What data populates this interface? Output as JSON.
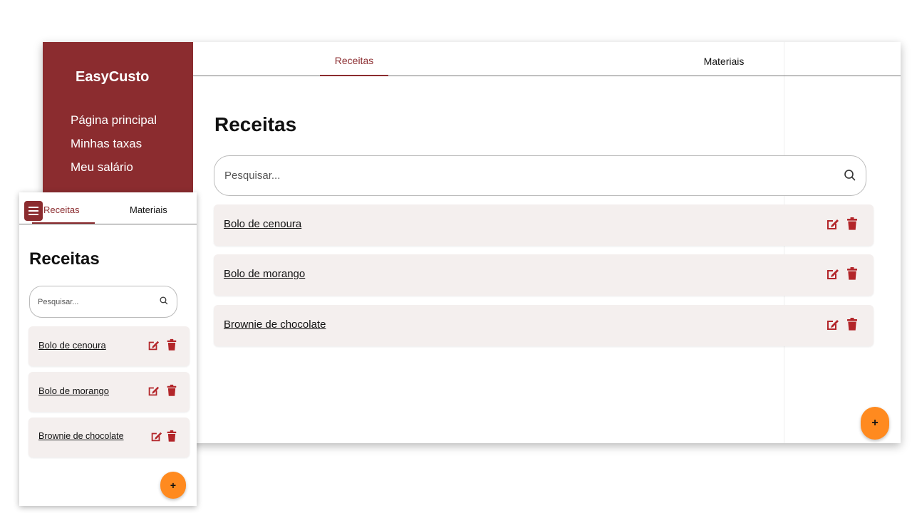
{
  "colors": {
    "brand": "#8b2c2f",
    "accent_fab": "#ff8a1f",
    "row_bg": "#f4efee",
    "icon_red": "#b3262a"
  },
  "desktop": {
    "brand": "EasyCusto",
    "sidebar": {
      "items": [
        {
          "label": "Página principal"
        },
        {
          "label": "Minhas taxas"
        },
        {
          "label": "Meu salário"
        }
      ]
    },
    "tabs": [
      {
        "label": "Receitas",
        "active": true
      },
      {
        "label": "Materiais",
        "active": false
      }
    ],
    "page_title": "Receitas",
    "search": {
      "placeholder": "Pesquisar...",
      "value": "",
      "icon": "search-icon"
    },
    "recipes": [
      {
        "name": "Bolo de cenoura"
      },
      {
        "name": "Bolo de morango"
      },
      {
        "name": "Brownie de chocolate"
      }
    ],
    "row_icons": {
      "edit": "edit-icon",
      "delete": "trash-icon"
    },
    "fab_label": "+"
  },
  "mobile": {
    "menu_icon": "hamburger-menu-icon",
    "tabs": [
      {
        "label": "Receitas",
        "active": true
      },
      {
        "label": "Materiais",
        "active": false
      }
    ],
    "page_title": "Receitas",
    "search": {
      "placeholder": "Pesquisar...",
      "value": "",
      "icon": "search-icon"
    },
    "recipes": [
      {
        "name": "Bolo de cenoura"
      },
      {
        "name": "Bolo de morango"
      },
      {
        "name": "Brownie de chocolate"
      }
    ],
    "fab_label": "+"
  }
}
